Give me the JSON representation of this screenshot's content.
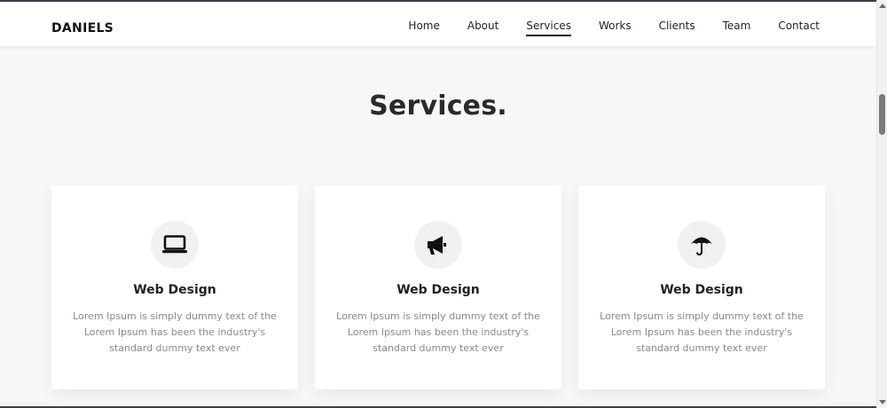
{
  "header": {
    "brand": "DANIELS",
    "nav": [
      {
        "label": "Home",
        "active": false
      },
      {
        "label": "About",
        "active": false
      },
      {
        "label": "Services",
        "active": true
      },
      {
        "label": "Works",
        "active": false
      },
      {
        "label": "Clients",
        "active": false
      },
      {
        "label": "Team",
        "active": false
      },
      {
        "label": "Contact",
        "active": false
      }
    ]
  },
  "services": {
    "title": "Services.",
    "cards": [
      {
        "icon": "laptop-icon",
        "title": "Web Design",
        "text": "Lorem Ipsum is simply dummy text of the Lorem Ipsum has been the industry's standard dummy text ever"
      },
      {
        "icon": "megaphone-icon",
        "title": "Web Design",
        "text": "Lorem Ipsum is simply dummy text of the Lorem Ipsum has been the industry's standard dummy text ever"
      },
      {
        "icon": "umbrella-icon",
        "title": "Web Design",
        "text": "Lorem Ipsum is simply dummy text of the Lorem Ipsum has been the industry's standard dummy text ever"
      }
    ]
  },
  "colors": {
    "background": "#f7f7f7",
    "card": "#ffffff",
    "text_dark": "#222222",
    "text_muted": "#8a8a8a"
  }
}
